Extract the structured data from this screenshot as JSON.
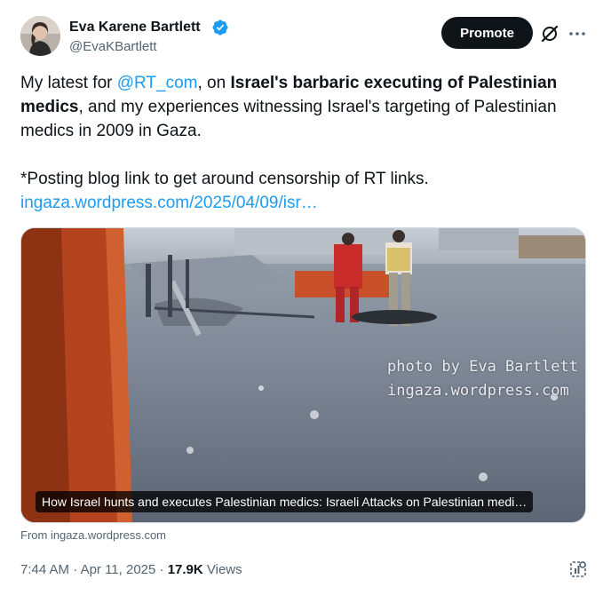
{
  "author": {
    "name": "Eva Karene Bartlett",
    "handle": "@EvaKBartlett",
    "verified": true
  },
  "actions": {
    "promote_label": "Promote",
    "grok_icon": "grok-icon",
    "more_icon": "more-dots-icon"
  },
  "tweet": {
    "p1_a": "My latest for ",
    "p1_mention": "@RT_com",
    "p1_b": ", on ",
    "p1_bold": "Israel's barbaric executing of Palestinian medics",
    "p1_c": ", and my experiences witnessing Israel's targeting of Palestinian medics in 2009 in Gaza.",
    "p2_text": "*Posting blog link to get around censorship of RT links.",
    "p2_link": "ingaza.wordpress.com/2025/04/09/isr…"
  },
  "media": {
    "watermark_line1": "photo by Eva Bartlett",
    "watermark_line2": "ingaza.wordpress.com",
    "caption": "How Israel hunts and executes Palestinian medics: Israeli Attacks on Palestinian medi…"
  },
  "source": "From ingaza.wordpress.com",
  "meta": {
    "time": "7:44 AM",
    "sep1": " · ",
    "date": "Apr 11, 2025",
    "sep2": " · ",
    "views_count": "17.9K",
    "views_label": " Views"
  },
  "colors": {
    "link": "#1d9bf0",
    "text": "#0f1419",
    "secondary": "#536471",
    "verified": "#1d9bf0"
  }
}
